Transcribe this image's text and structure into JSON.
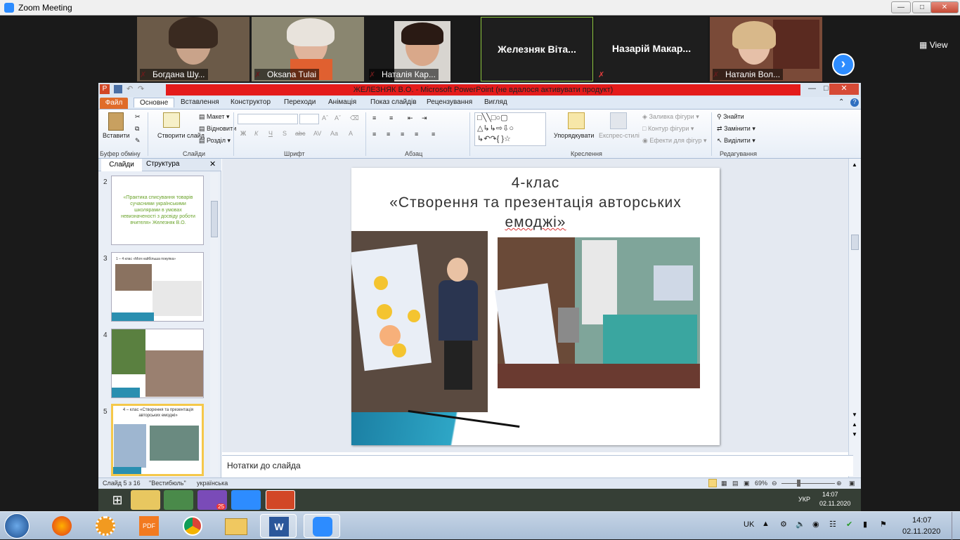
{
  "zoom": {
    "window_title": "Zoom Meeting",
    "view_label": "View",
    "participants": [
      {
        "name": "Богдана Шу..."
      },
      {
        "name": "Oksana Tulai"
      },
      {
        "name": "Наталія Кар..."
      },
      {
        "name": "Железняк Віта...",
        "big": true
      },
      {
        "name": "Назарій Макар...",
        "big": true
      },
      {
        "name": "Наталія Вол..."
      }
    ]
  },
  "powerpoint": {
    "title": "ЖЕЛЕЗНЯК В.О. - Microsoft PowerPoint (не вдалося активувати продукт)",
    "tabs": [
      "Файл",
      "Основне",
      "Вставлення",
      "Конструктор",
      "Переходи",
      "Анімація",
      "Показ слайдів",
      "Рецензування",
      "Вигляд"
    ],
    "ribbon": {
      "paste": "Вставити",
      "clipboard_group": "Буфер обміну",
      "new_slide": "Створити слайд",
      "layout": "Макет",
      "reset": "Відновити",
      "section": "Розділ",
      "slides_group": "Слайди",
      "font_group": "Шрифт",
      "paragraph_group": "Абзац",
      "arrange": "Упорядкувати",
      "quick_styles": "Експрес-стилі",
      "shape_fill": "Заливка фігури",
      "shape_outline": "Контур фігури",
      "shape_effects": "Ефекти для фігур",
      "drawing_group": "Креслення",
      "find": "Знайти",
      "replace": "Замінити",
      "select": "Виділити",
      "editing_group": "Редагування"
    },
    "panel_tabs": [
      "Слайди",
      "Структура"
    ],
    "thumbs": [
      {
        "num": "2",
        "text": "«Практика списування товарів сучасними українськими школярами в умовах невизначеності з досвіду роботи вчителя» Железняк В.О."
      },
      {
        "num": "3",
        "text": "1 – 4 клас «Моя найбільша покупка»"
      },
      {
        "num": "4",
        "text": ""
      },
      {
        "num": "5",
        "text": "4 – клас «Створення та презентація авторських емоджі»"
      }
    ],
    "slide": {
      "line1": "4-клас",
      "line2": "«Створення та презентація авторських",
      "line3": "емоджі»"
    },
    "notes_placeholder": "Нотатки до слайда",
    "status": {
      "slide_of": "Слайд 5 з 16",
      "theme": "\"Вестибюль\"",
      "language": "українська",
      "zoom": "69%"
    }
  },
  "taskbar": {
    "lang": "UK",
    "inner_lang": "УКР",
    "inner_time": "14:07",
    "inner_date": "02.11.2020",
    "time": "14:07",
    "date": "02.11.2020",
    "viber_badge": "25"
  }
}
